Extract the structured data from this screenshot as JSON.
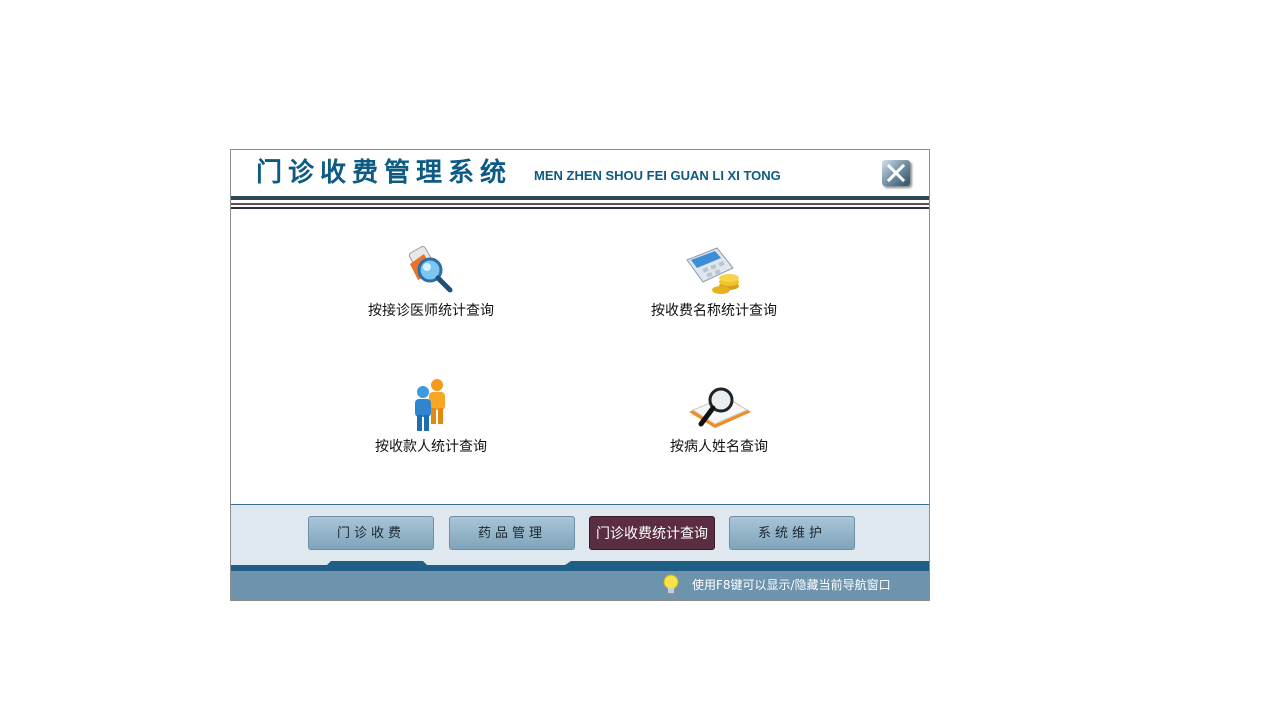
{
  "app": {
    "title_cn": "门诊收费管理系统",
    "title_en": "MEN ZHEN SHOU FEI GUAN LI XI TONG"
  },
  "menu": [
    {
      "label": "按接诊医师统计查询",
      "icon": "doctor-search-icon"
    },
    {
      "label": "按收费名称统计查询",
      "icon": "calculator-coins-icon"
    },
    {
      "label": "按收款人统计查询",
      "icon": "people-icon"
    },
    {
      "label": "按病人姓名查询",
      "icon": "magnifier-document-icon"
    }
  ],
  "nav": [
    {
      "label": "门诊收费",
      "active": false
    },
    {
      "label": "药品管理",
      "active": false
    },
    {
      "label": "门诊收费统计查询",
      "active": true
    },
    {
      "label": "系统维护",
      "active": false
    }
  ],
  "status": {
    "hint": "使用F8键可以显示/隐藏当前导航窗口"
  },
  "colors": {
    "brand": "#0d5a83",
    "active_button": "#5a2d42",
    "statusbar": "#6d93ad",
    "nav_button": "#8fb0c4"
  }
}
